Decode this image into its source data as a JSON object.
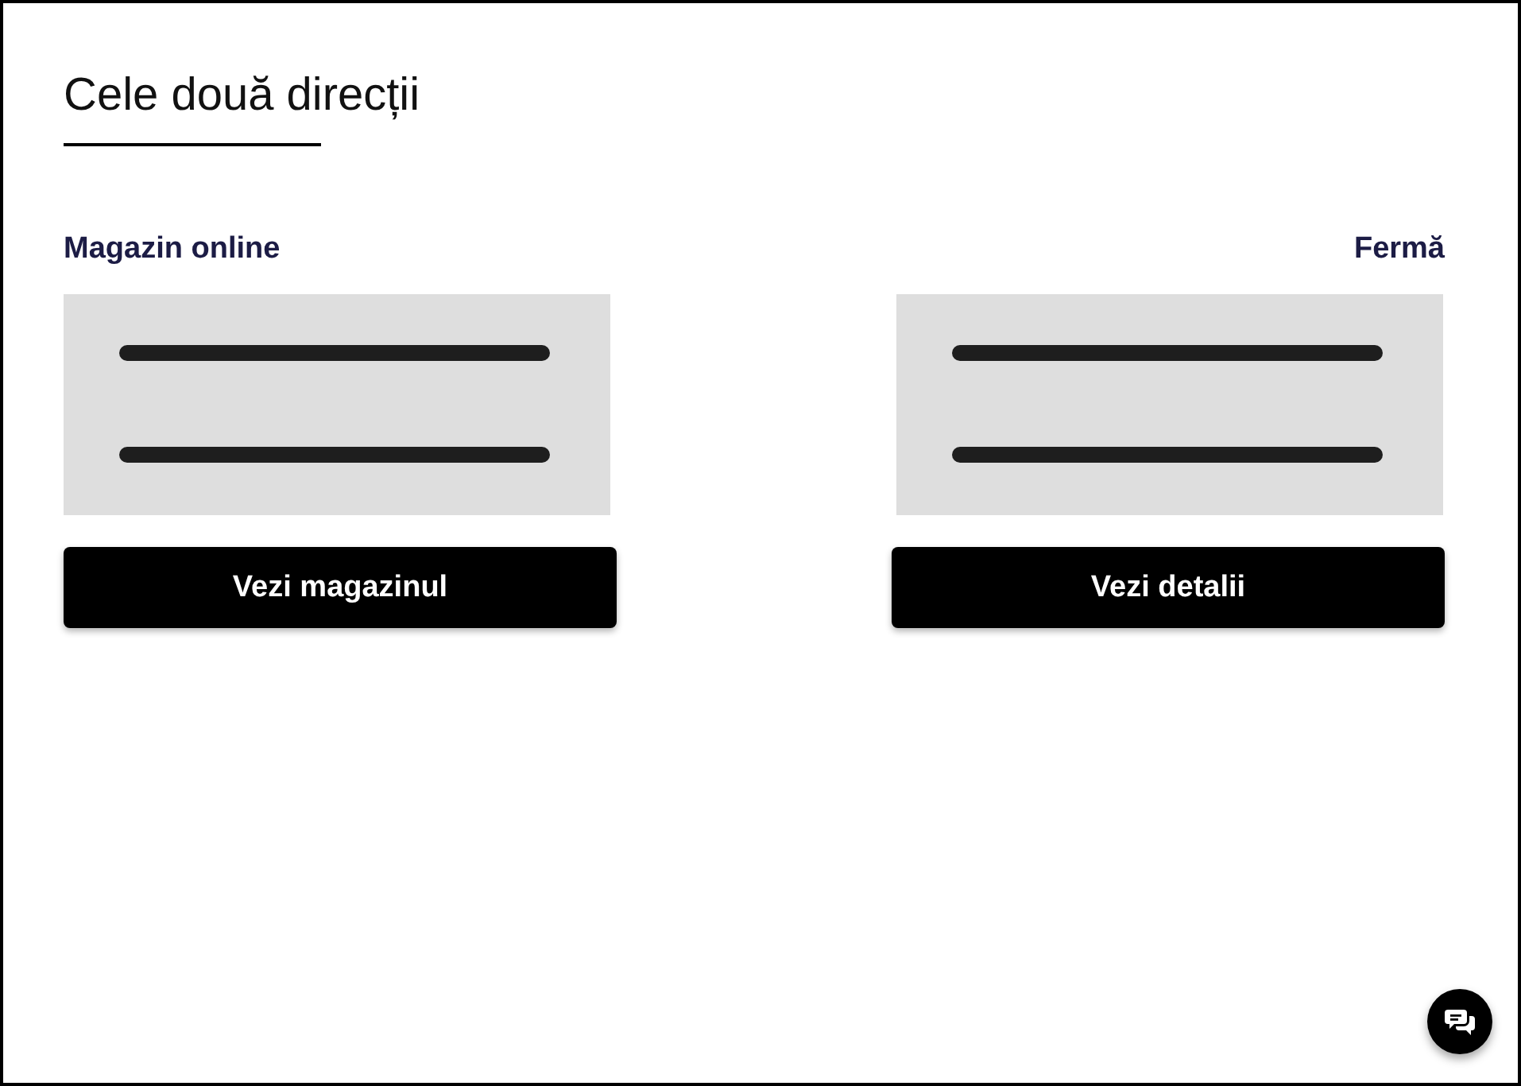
{
  "title": "Cele două direcții",
  "columns": [
    {
      "heading": "Magazin online",
      "button": "Vezi magazinul"
    },
    {
      "heading": "Fermă",
      "button": "Vezi detalii"
    }
  ]
}
